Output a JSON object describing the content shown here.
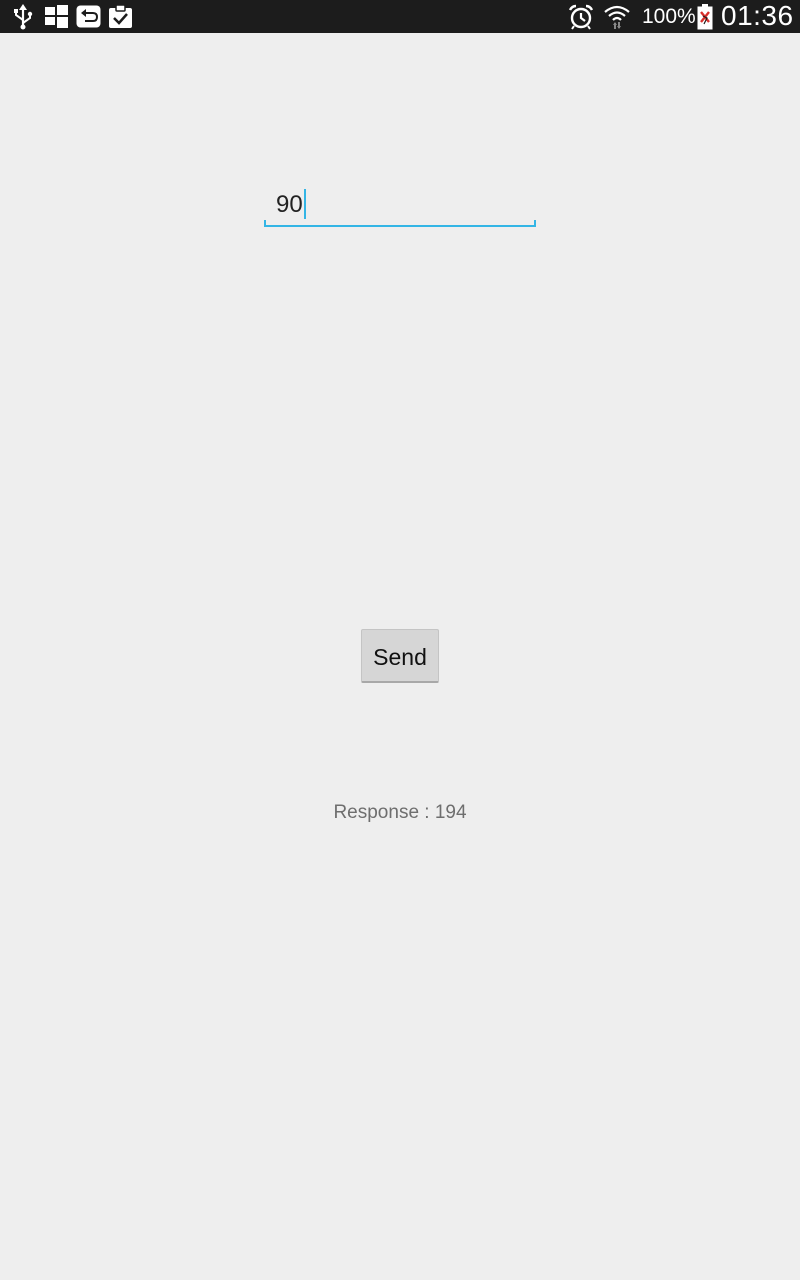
{
  "status_bar": {
    "left_icons": [
      "usb-icon",
      "windows-icon",
      "undo-icon",
      "clipboard-check-icon"
    ],
    "right_icons": [
      "alarm-icon",
      "wifi-icon",
      "battery-icon"
    ],
    "battery_percent": "100%",
    "clock": "01:36"
  },
  "form": {
    "input_value": "90",
    "send_label": "Send",
    "response_text": "Response : 194"
  },
  "colors": {
    "background": "#eeeeee",
    "status_bar": "#1c1c1c",
    "accent": "#33b5e5",
    "button": "#d6d6d6",
    "response_text": "#6e6e6e"
  }
}
